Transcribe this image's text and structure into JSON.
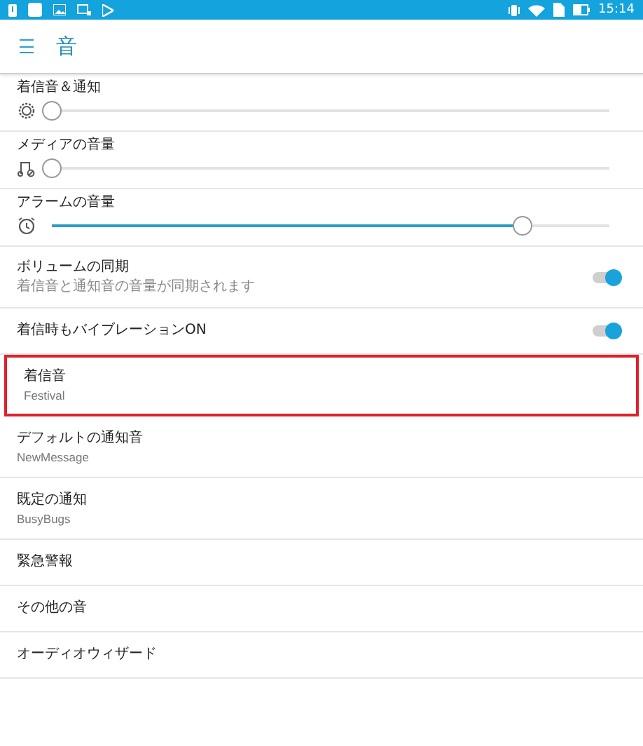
{
  "status_bar": {
    "time": "15:14"
  },
  "header": {
    "title": "音"
  },
  "volumes": [
    {
      "label": "着信音＆通知",
      "kind": "vibrate",
      "level": 0.0
    },
    {
      "label": "メディアの音量",
      "kind": "music",
      "level": 0.0
    },
    {
      "label": "アラームの音量",
      "kind": "alarm",
      "level": 0.86
    }
  ],
  "toggles": [
    {
      "label": "ボリュームの同期",
      "subtitle": "着信音と通知音の音量が同期されます",
      "on": true
    },
    {
      "label": "着信時もバイブレーションON",
      "on": true
    }
  ],
  "items": [
    {
      "label": "着信音",
      "subtitle": "Festival",
      "highlighted": true
    },
    {
      "label": "デフォルトの通知音",
      "subtitle": "NewMessage",
      "highlighted": false
    },
    {
      "label": "既定の通知",
      "subtitle": "BusyBugs",
      "highlighted": false
    },
    {
      "label": "緊急警報",
      "highlighted": false
    },
    {
      "label": "その他の音",
      "highlighted": false
    },
    {
      "label": "オーディオウィザード",
      "highlighted": false
    }
  ]
}
